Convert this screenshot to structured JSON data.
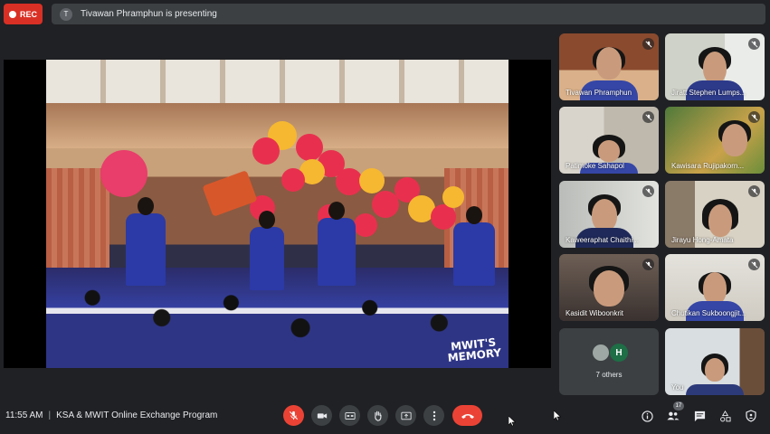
{
  "recording": {
    "label": "REC"
  },
  "presenting": {
    "avatar_letter": "T",
    "text": "Tivawan Phramphun is presenting"
  },
  "presentation": {
    "watermark_line1": "MWIT'S",
    "watermark_line2": "MEMORY"
  },
  "participants": [
    {
      "name": "Tivawan Phramphun",
      "muted": true
    },
    {
      "name": "Jiratt Stephen Lumps...",
      "muted": true
    },
    {
      "name": "Patimoke Sahapol",
      "muted": true
    },
    {
      "name": "Kawisara Rujipakorn...",
      "muted": true
    },
    {
      "name": "Kaweeraphat Chaithi...",
      "muted": true
    },
    {
      "name": "Jirayu Hong-Amata",
      "muted": true
    },
    {
      "name": "Kasidit Wiboonkrit",
      "muted": true
    },
    {
      "name": "Chutikan Sukboongjit...",
      "muted": true
    },
    {
      "name": "You",
      "muted": false
    }
  ],
  "others_tile": {
    "avatar_letter": "H",
    "label": "7 others"
  },
  "bottom_bar": {
    "time": "11:55 AM",
    "separator": "|",
    "meeting_title": "KSA & MWIT Online Exchange Program",
    "people_count": "17"
  },
  "colors": {
    "background": "#202124",
    "tile": "#3c4043",
    "danger": "#ea4335",
    "shirt_blue": "#3546a6"
  }
}
